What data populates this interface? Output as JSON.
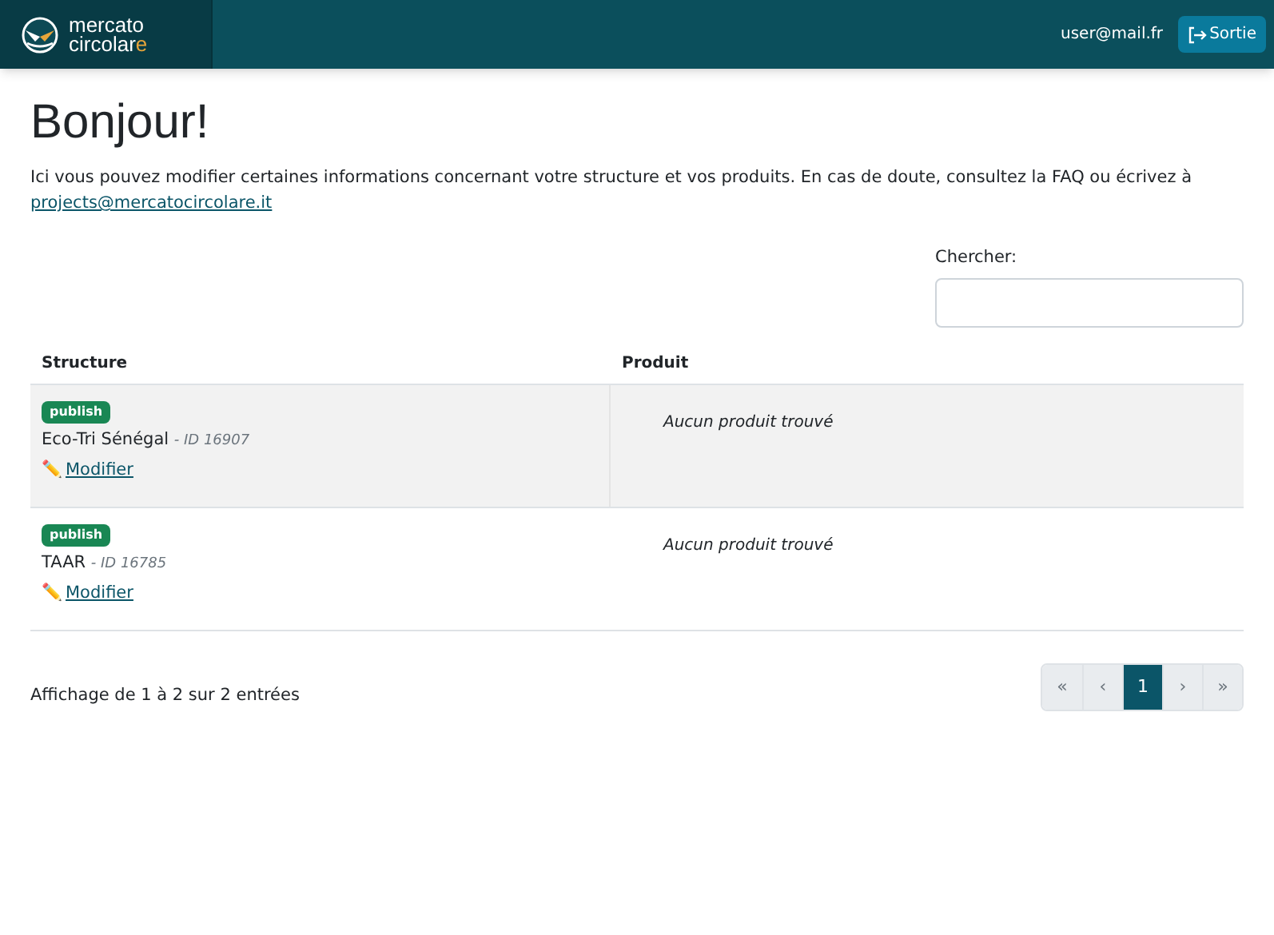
{
  "header": {
    "logo": {
      "line1": "mercato",
      "line2": "circolar",
      "accent": "e"
    },
    "user": "user@mail.fr",
    "logout": "Sortie"
  },
  "title": "Bonjour!",
  "intro": "Ici vous pouvez modifier certaines informations concernant votre structure et vos produits. En cas de doute, consultez la FAQ ou écrivez à",
  "email": "projects@mercatocircolare.it",
  "search": {
    "label": "Chercher:"
  },
  "table": {
    "columns": [
      "Structure",
      "Produit"
    ],
    "rows": [
      {
        "highlighted": true,
        "status": "publish",
        "name": "Eco-Tri Sénégal",
        "id": "- ID 16907",
        "edit_icon": "✏️",
        "edit": "Modifier",
        "product": "Aucun produit trouvé"
      },
      {
        "highlighted": false,
        "status": "publish",
        "name": "TAAR",
        "id": "- ID 16785",
        "edit_icon": "✏️",
        "edit": "Modifier",
        "product": "Aucun produit trouvé"
      }
    ]
  },
  "info": "Affichage de 1 à 2 sur 2 entrées",
  "pagination": [
    {
      "label": "«",
      "selected": false,
      "disabled": true
    },
    {
      "label": "‹",
      "selected": false,
      "disabled": true
    },
    {
      "label": "1",
      "selected": true,
      "disabled": false
    },
    {
      "label": "›",
      "selected": false,
      "disabled": true
    },
    {
      "label": "»",
      "selected": false,
      "disabled": true
    }
  ]
}
